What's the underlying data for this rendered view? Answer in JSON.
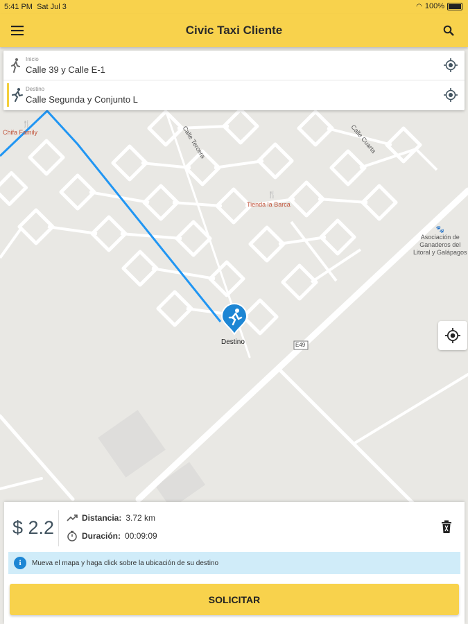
{
  "status_bar": {
    "time": "5:41 PM",
    "date": "Sat Jul 3",
    "battery": "100%"
  },
  "header": {
    "title": "Civic Taxi Cliente",
    "menu_icon": "hamburger-menu-icon",
    "search_icon": "search-icon"
  },
  "route_card": {
    "origin": {
      "label": "Inicio",
      "value": "Calle 39 y Calle E-1",
      "icon": "walking-person-icon"
    },
    "destination": {
      "label": "Destino",
      "value": "Calle Segunda y Conjunto L",
      "icon": "running-person-icon"
    }
  },
  "map": {
    "labels": {
      "chifa": "Chifa Family",
      "calle_tercera": "Calle Tercera",
      "calle_cuarta": "Calle Cuarta",
      "tienda": "Tienda la Barca",
      "asociacion": [
        "Asociación de",
        "Ganaderos del",
        "Litoral y Galápagos"
      ],
      "road_shield": "E49",
      "destino_marker": "Destino"
    },
    "route_color": "#2196f3"
  },
  "summary": {
    "price": "$ 2.2",
    "distance_label": "Distancia:",
    "distance_value": "3.72 km",
    "duration_label": "Duración:",
    "duration_value": "00:09:09"
  },
  "info_message": "Mueva el mapa y haga click sobre la ubicación de su destino",
  "primary_button": "SOLICITAR",
  "colors": {
    "brand_yellow": "#f8d24c",
    "route_blue": "#2196f3",
    "info_bg": "#d0ecf9"
  }
}
